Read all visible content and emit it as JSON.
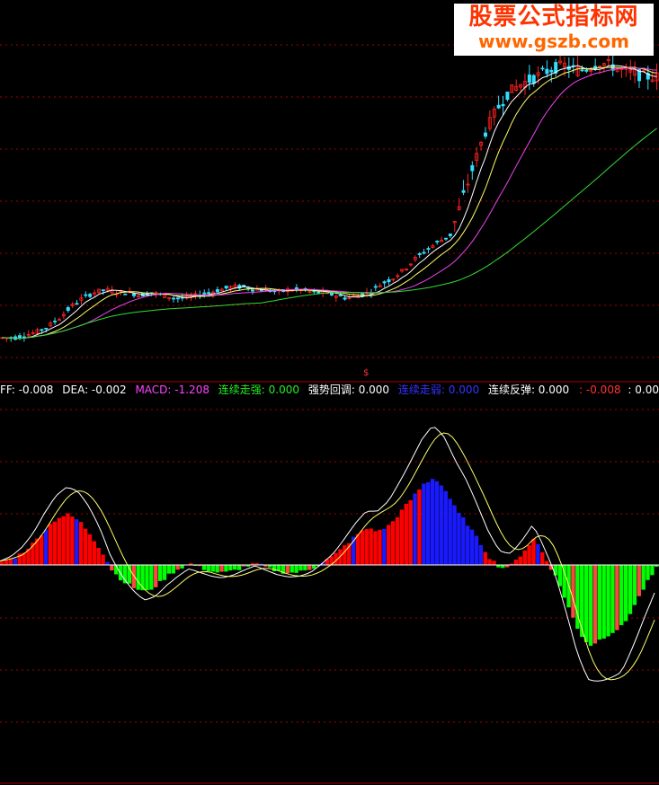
{
  "watermark": {
    "line1": "股票公式指标网",
    "line2": "www.gszb.com"
  },
  "legend": [
    {
      "text": "FF: -0.008",
      "color": "#ffffff"
    },
    {
      "text": "DEA: -0.002",
      "color": "#ffffff"
    },
    {
      "text": "MACD: -1.208",
      "color": "#ff44ff"
    },
    {
      "text": "连续走强: 0.000",
      "color": "#22ee22"
    },
    {
      "text": "强势回调: 0.000",
      "color": "#ffffff"
    },
    {
      "text": "连续走弱: 0.000",
      "color": "#3333ff"
    },
    {
      "text": "连续反弹: 0.000",
      "color": "#ffffff"
    }
  ],
  "legend_right": [
    {
      "text": ": -0.008",
      "color": "#ff3333"
    },
    {
      "text": ": 0.00",
      "color": "#ffffff"
    }
  ],
  "marker": "$",
  "colors": {
    "up": "#ff2222",
    "down": "#33ddff",
    "ma_fast": "#ffffff",
    "ma_mid": "#ffff66",
    "ma_slow": "#ee44ee",
    "ma_long": "#33dd33",
    "grid": "#aa0000",
    "hist_red": "#ff0000",
    "hist_blue": "#1a1aff",
    "hist_green": "#00ff00",
    "hist_stripe": "#ff4444"
  },
  "chart_data": {
    "type": "line",
    "price_trend": [
      100,
      100,
      101,
      102,
      104,
      107,
      111,
      114,
      116,
      117,
      116,
      116,
      115,
      116,
      115,
      114,
      114,
      115,
      116,
      117,
      118,
      118,
      117,
      117,
      116,
      117,
      117,
      116,
      116,
      115,
      114,
      115,
      116,
      119,
      121,
      124,
      128,
      131,
      134,
      136,
      148,
      160,
      172,
      180,
      186,
      189,
      191,
      193,
      195,
      196,
      194,
      195,
      197,
      196,
      194,
      193,
      192,
      192
    ],
    "macd_hist_shape": [
      0.05,
      0.1,
      0.2,
      0.35,
      0.55,
      0.7,
      0.75,
      0.65,
      0.45,
      0.2,
      -0.1,
      -0.25,
      -0.35,
      -0.4,
      -0.3,
      -0.15,
      -0.05,
      0.02,
      -0.05,
      -0.1,
      -0.12,
      -0.08,
      -0.02,
      0.02,
      -0.05,
      -0.1,
      -0.12,
      -0.1,
      -0.05,
      0.05,
      0.15,
      0.3,
      0.45,
      0.55,
      0.5,
      0.6,
      0.8,
      1.0,
      1.2,
      1.3,
      1.1,
      0.8,
      0.6,
      0.35,
      0.1,
      -0.05,
      0.0,
      0.2,
      0.4,
      0.1,
      -0.2,
      -0.6,
      -1.0,
      -1.2,
      -1.1,
      -1.0,
      -0.9,
      -0.6,
      -0.3,
      -0.05
    ]
  }
}
